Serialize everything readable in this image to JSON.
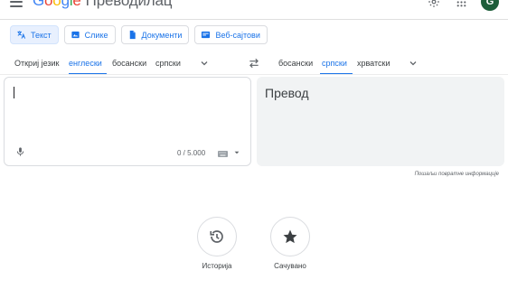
{
  "header": {
    "logo_letters": [
      "G",
      "o",
      "o",
      "g",
      "l",
      "e"
    ],
    "product_name": "Преводилац",
    "avatar_initial": "G"
  },
  "modes": [
    {
      "label": "Текст",
      "icon": "translate-icon",
      "active": true
    },
    {
      "label": "Слике",
      "icon": "image-icon",
      "active": false
    },
    {
      "label": "Документи",
      "icon": "document-icon",
      "active": false
    },
    {
      "label": "Веб-сајтови",
      "icon": "website-icon",
      "active": false
    }
  ],
  "source_languages": {
    "detect": "Откриј језик",
    "items": [
      "енглески",
      "босански",
      "српски"
    ],
    "active": "енглески"
  },
  "target_languages": {
    "items": [
      "босански",
      "српски",
      "хрватски"
    ],
    "active": "српски"
  },
  "source": {
    "value": "",
    "char_count": "0 / 5.000"
  },
  "target": {
    "placeholder": "Превод"
  },
  "feedback_link": "Пошаљи повратне информације",
  "bottom": {
    "history_label": "Историја",
    "saved_label": "Сачувано"
  },
  "colors": {
    "accent": "#1a73e8",
    "avatar_bg": "#1e5e3a",
    "target_bg": "#f1f3f4"
  }
}
